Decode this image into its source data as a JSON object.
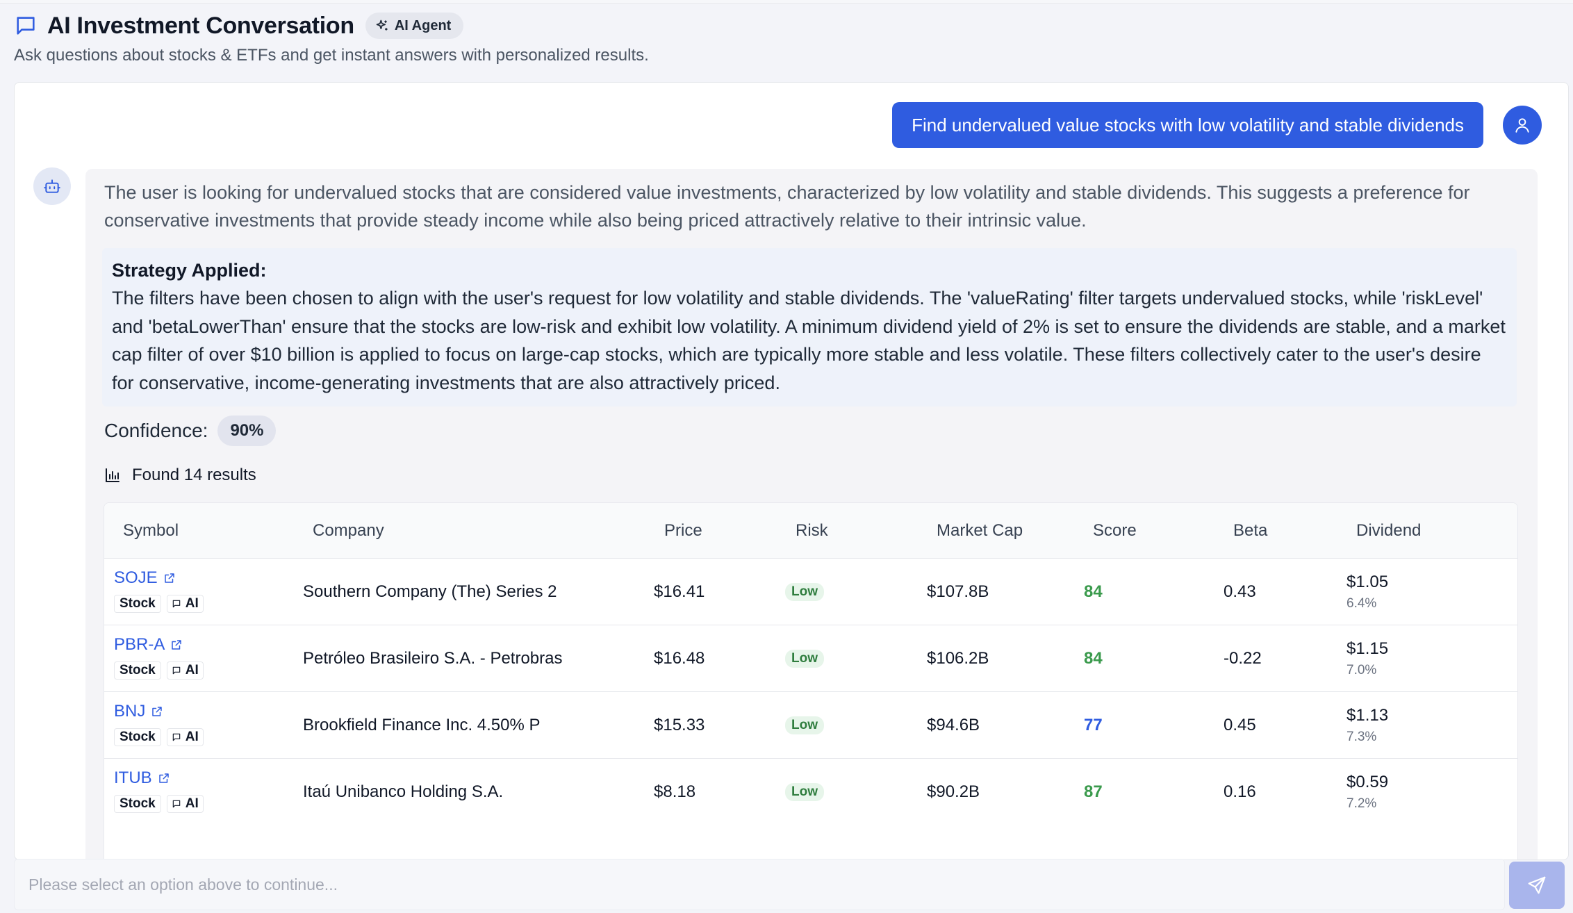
{
  "header": {
    "title": "AI Investment Conversation",
    "agent_badge": "AI Agent",
    "subtitle": "Ask questions about stocks & ETFs and get instant answers with personalized results."
  },
  "conversation": {
    "user_message": "Find undervalued value stocks with low volatility and stable dividends",
    "bot": {
      "intro": "The user is looking for undervalued stocks that are considered value investments, characterized by low volatility and stable dividends. This suggests a preference for conservative investments that provide steady income while also being priced attractively relative to their intrinsic value.",
      "strategy_title": "Strategy Applied:",
      "strategy_text": "The filters have been chosen to align with the user's request for low volatility and stable dividends. The 'valueRating' filter targets undervalued stocks, while 'riskLevel' and 'betaLowerThan' ensure that the stocks are low-risk and exhibit low volatility. A minimum dividend yield of 2% is set to ensure the dividends are stable, and a market cap filter of over $10 billion is applied to focus on large-cap stocks, which are typically more stable and less volatile. These filters collectively cater to the user's desire for conservative, income-generating investments that are also attractively priced.",
      "confidence_label": "Confidence:",
      "confidence_value": "90%",
      "found_text": "Found 14 results"
    }
  },
  "table": {
    "columns": [
      "Symbol",
      "Company",
      "Price",
      "Risk",
      "Market Cap",
      "Score",
      "Beta",
      "Dividend"
    ],
    "tag_stock": "Stock",
    "tag_ai": "AI",
    "rows": [
      {
        "symbol": "SOJE",
        "company": "Southern Company (The) Series 2",
        "price": "$16.41",
        "risk": "Low",
        "market_cap": "$107.8B",
        "score": "84",
        "score_color": "#3a9a4c",
        "beta": "0.43",
        "dividend": "$1.05",
        "yield": "6.4%"
      },
      {
        "symbol": "PBR-A",
        "company": "Petróleo Brasileiro S.A. - Petrobras",
        "price": "$16.48",
        "risk": "Low",
        "market_cap": "$106.2B",
        "score": "84",
        "score_color": "#3a9a4c",
        "beta": "-0.22",
        "dividend": "$1.15",
        "yield": "7.0%"
      },
      {
        "symbol": "BNJ",
        "company": "Brookfield Finance Inc. 4.50% P",
        "price": "$15.33",
        "risk": "Low",
        "market_cap": "$94.6B",
        "score": "77",
        "score_color": "#2f5ce0",
        "beta": "0.45",
        "dividend": "$1.13",
        "yield": "7.3%"
      },
      {
        "symbol": "ITUB",
        "company": "Itaú Unibanco Holding S.A.",
        "price": "$8.18",
        "risk": "Low",
        "market_cap": "$90.2B",
        "score": "87",
        "score_color": "#3a9a4c",
        "beta": "0.16",
        "dividend": "$0.59",
        "yield": "7.2%"
      }
    ]
  },
  "input": {
    "placeholder": "Please select an option above to continue..."
  },
  "colors": {
    "accent": "#2f5ce0",
    "send_disabled": "#a9b5ec",
    "risk_low_bg": "#e7f5ea",
    "risk_low_text": "#2f7d3e"
  }
}
